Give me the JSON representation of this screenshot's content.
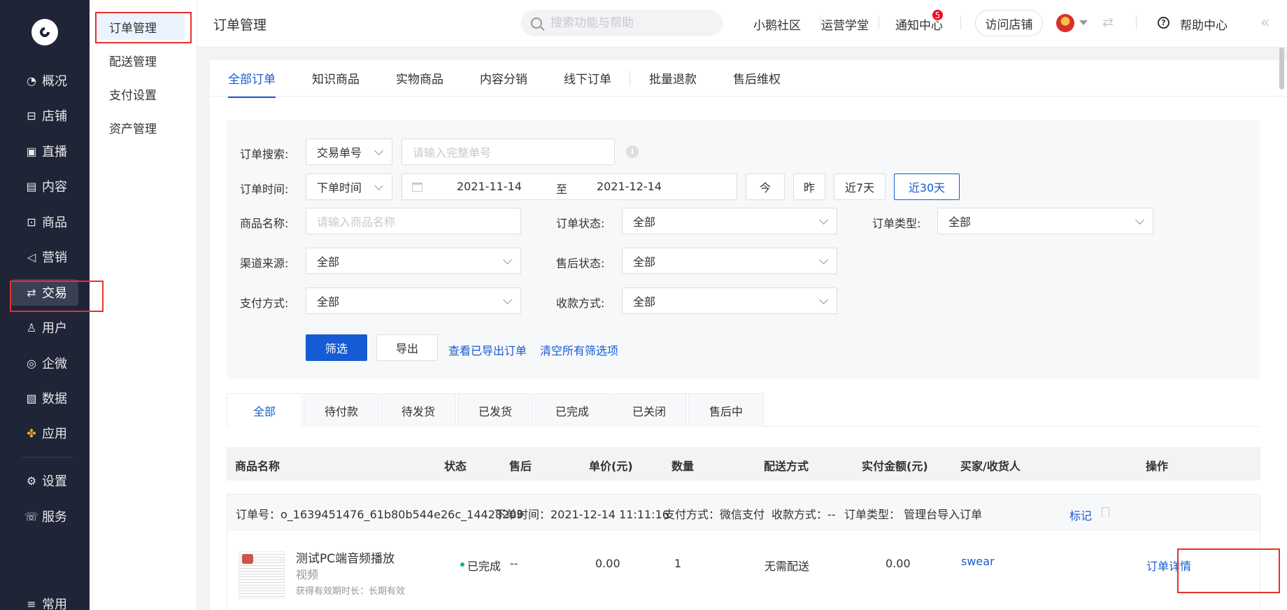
{
  "sidebar": {
    "items": [
      {
        "label": "概况",
        "icon": "pie-chart-icon",
        "active": false
      },
      {
        "label": "店铺",
        "icon": "store-icon",
        "active": false
      },
      {
        "label": "直播",
        "icon": "live-icon",
        "active": false
      },
      {
        "label": "内容",
        "icon": "document-icon",
        "active": false
      },
      {
        "label": "商品",
        "icon": "box-icon",
        "active": false
      },
      {
        "label": "营销",
        "icon": "megaphone-icon",
        "active": false
      },
      {
        "label": "交易",
        "icon": "exchange-icon",
        "active": true
      },
      {
        "label": "用户",
        "icon": "user-icon",
        "active": false
      },
      {
        "label": "企微",
        "icon": "wecom-icon",
        "active": false
      },
      {
        "label": "数据",
        "icon": "chart-icon",
        "active": false
      },
      {
        "label": "应用",
        "icon": "apps-icon",
        "active": false
      }
    ],
    "bottom_items": [
      {
        "label": "设置",
        "icon": "gear-icon"
      },
      {
        "label": "服务",
        "icon": "service-icon"
      },
      {
        "label": "常用",
        "icon": "menu-icon"
      }
    ]
  },
  "subnav": {
    "items": [
      "订单管理",
      "配送管理",
      "支付设置",
      "资产管理"
    ],
    "active_index": 0
  },
  "topbar": {
    "title": "订单管理",
    "search_placeholder": "搜索功能与帮助",
    "links": [
      "小鹅社区",
      "运营学堂",
      "通知中心"
    ],
    "notification_count": "5",
    "visit_store": "访问店铺",
    "help": "帮助中心"
  },
  "tabs": [
    "全部订单",
    "知识商品",
    "实物商品",
    "内容分销",
    "线下订单",
    "批量退款",
    "售后维权"
  ],
  "filter": {
    "order_search_label": "订单搜索:",
    "order_search_type": "交易单号",
    "order_search_placeholder": "请输入完整单号",
    "order_time_label": "订单时间:",
    "order_time_type": "下单时间",
    "date_start": "2021-11-14",
    "date_to": "至",
    "date_end": "2021-12-14",
    "quick_today": "今",
    "quick_yesterday": "昨",
    "quick_7d": "近7天",
    "quick_30d": "近30天",
    "product_name_label": "商品名称:",
    "product_name_placeholder": "请输入商品名称",
    "order_status_label": "订单状态:",
    "order_status_value": "全部",
    "order_type_label": "订单类型:",
    "order_type_value": "全部",
    "channel_label": "渠道来源:",
    "channel_value": "全部",
    "aftersale_label": "售后状态:",
    "aftersale_value": "全部",
    "pay_method_label": "支付方式:",
    "pay_method_value": "全部",
    "collect_label": "收款方式:",
    "collect_value": "全部",
    "filter_btn": "筛选",
    "export_btn": "导出",
    "view_exported": "查看已导出订单",
    "clear_all": "清空所有筛选项"
  },
  "status_tabs": [
    "全部",
    "待付款",
    "待发货",
    "已发货",
    "已完成",
    "已关闭",
    "售后中"
  ],
  "table": {
    "headers": [
      "商品名称",
      "状态",
      "售后",
      "单价(元)",
      "数量",
      "配送方式",
      "实付金额(元)",
      "买家/收货人",
      "操作"
    ]
  },
  "order": {
    "order_no": "订单号：o_1639451476_61b80b544e26c_14428209",
    "order_time": "下单时间：2021-12-14 11:11:16",
    "pay_method": "支付方式：微信支付",
    "collect_method": "收款方式：--",
    "order_type": "订单类型：  管理台导入订单",
    "mark": "标记",
    "product_name": "测试PC端音频播放",
    "product_type": "视频",
    "validity": "获得有效期时长：长期有效",
    "status": "已完成",
    "aftersale": "--",
    "unit_price": "0.00",
    "quantity": "1",
    "delivery": "无需配送",
    "paid_amount": "0.00",
    "buyer": "swear",
    "action": "订单详情"
  }
}
